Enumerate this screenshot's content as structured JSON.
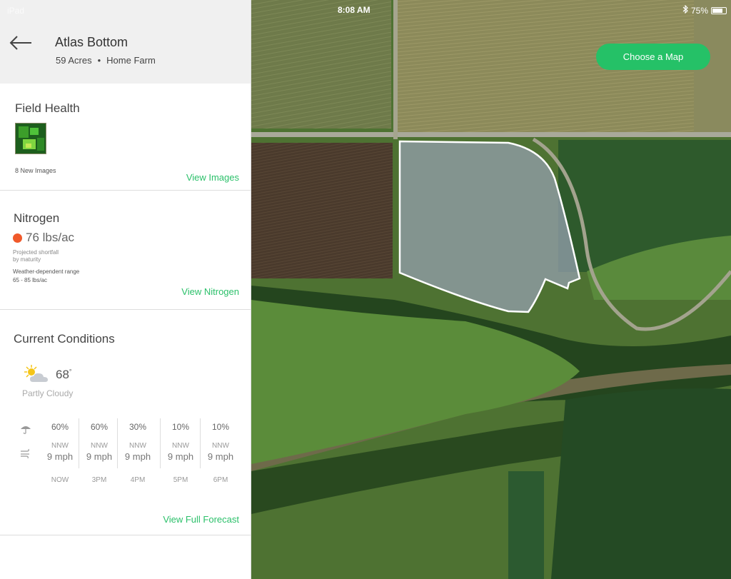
{
  "status": {
    "device": "iPad",
    "time": "8:08 AM",
    "battery": "75%",
    "battery_fraction": 0.75
  },
  "field": {
    "name": "Atlas Bottom",
    "acres": "59 Acres",
    "farm": "Home Farm"
  },
  "field_health": {
    "title": "Field Health",
    "images_note": "8 New Images",
    "link": "View Images"
  },
  "nitrogen": {
    "title": "Nitrogen",
    "value": "76 lbs/ac",
    "status_color": "#f0592a",
    "shortfall_label_1": "Projected shortfall",
    "shortfall_label_2": "by maturity",
    "range_label": "Weather-dependent range",
    "range_value": "65 - 85 lbs/ac",
    "link": "View Nitrogen"
  },
  "conditions": {
    "title": "Current Conditions",
    "temperature": "68",
    "degree": "°",
    "summary": "Partly Cloudy",
    "forecast": [
      {
        "precip": "60%",
        "dir": "NNW",
        "speed": "9 mph",
        "time": "NOW"
      },
      {
        "precip": "60%",
        "dir": "NNW",
        "speed": "9 mph",
        "time": "3PM"
      },
      {
        "precip": "30%",
        "dir": "NNW",
        "speed": "9 mph",
        "time": "4PM"
      },
      {
        "precip": "10%",
        "dir": "NNW",
        "speed": "9 mph",
        "time": "5PM"
      },
      {
        "precip": "10%",
        "dir": "NNW",
        "speed": "9 mph",
        "time": "6PM"
      }
    ],
    "link": "View Full Forecast"
  },
  "map": {
    "button": "Choose a Map",
    "accent": "#25c167"
  }
}
